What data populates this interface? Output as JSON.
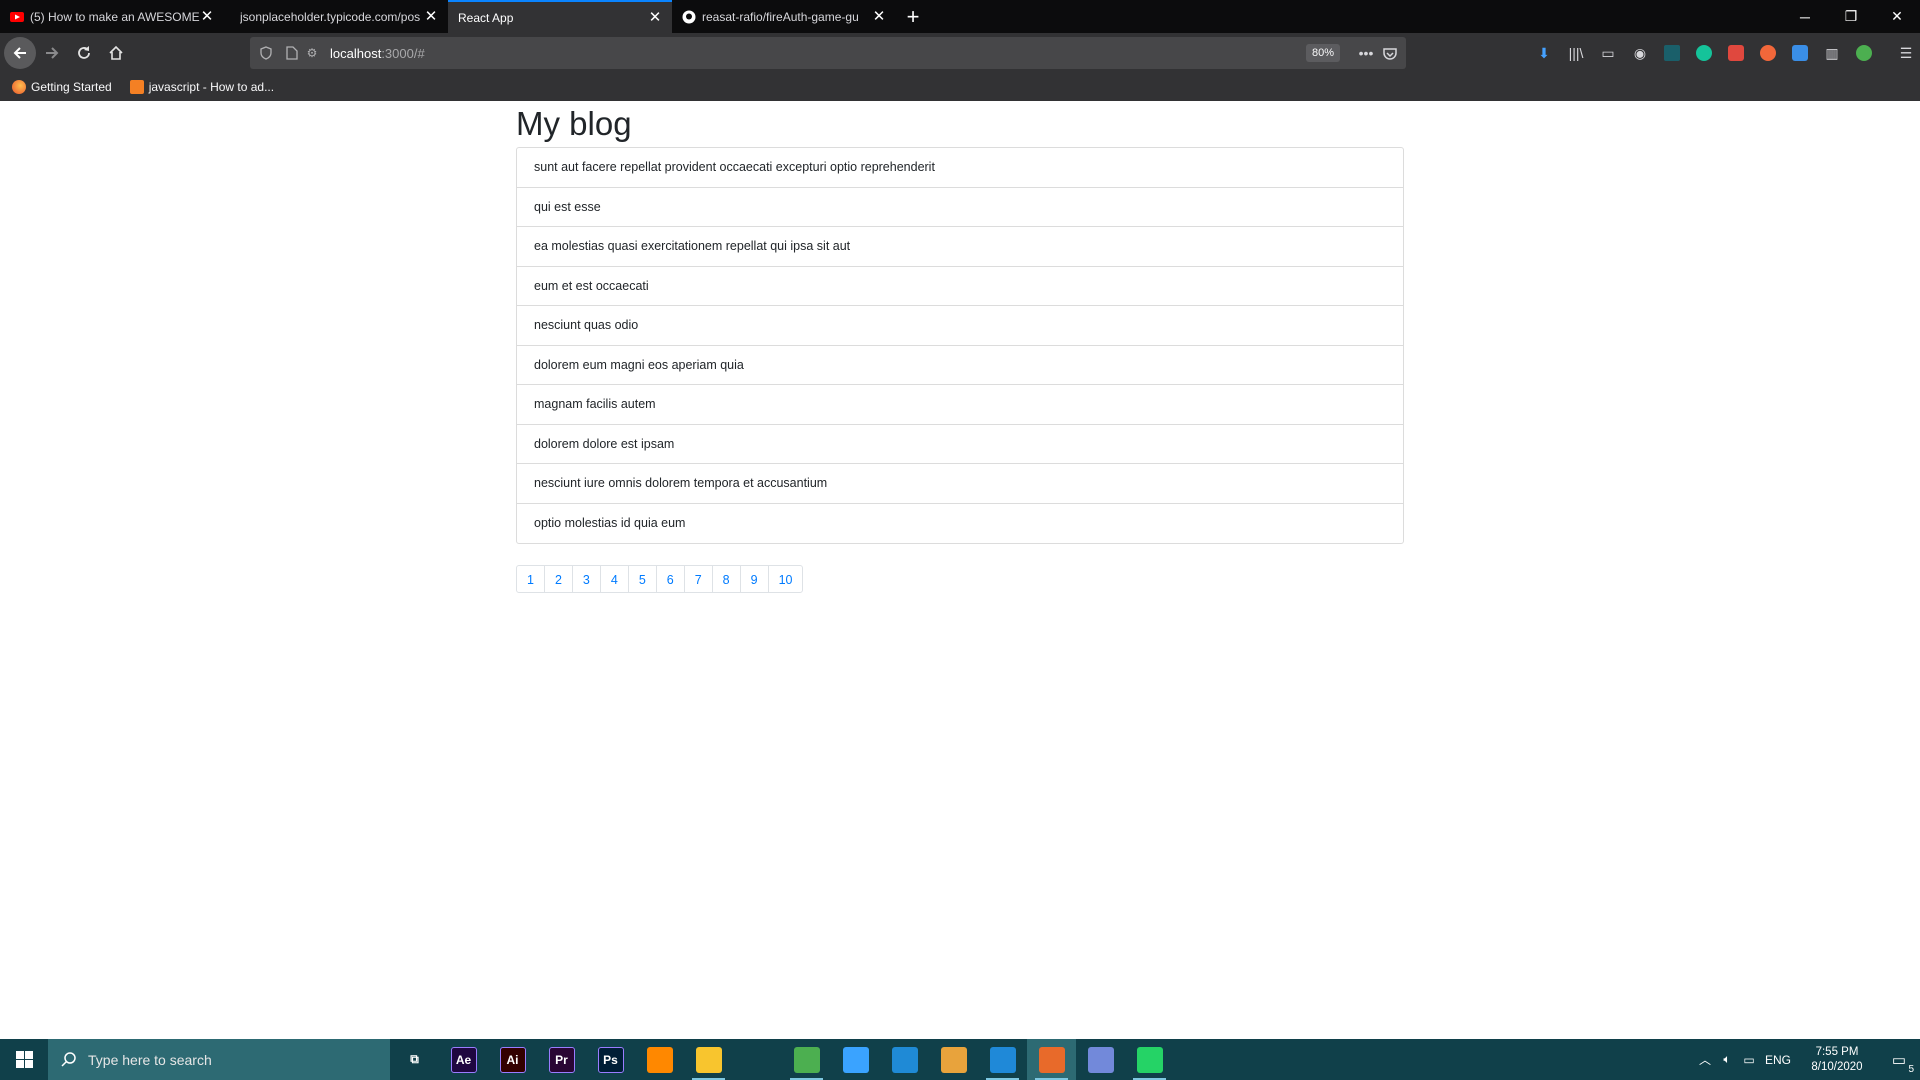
{
  "browser": {
    "tabs": [
      {
        "title": "(5) How to make an AWESOME",
        "active": false,
        "favicon": "youtube-icon"
      },
      {
        "title": "jsonplaceholder.typicode.com/pos",
        "active": false,
        "favicon": "none"
      },
      {
        "title": "React App",
        "active": true,
        "favicon": "none"
      },
      {
        "title": "reasat-rafio/fireAuth-game-gu",
        "active": false,
        "favicon": "github-icon"
      }
    ],
    "url_host": "localhost",
    "url_path": ":3000/#",
    "zoom": "80%",
    "bookmarks": [
      {
        "label": "Getting Started",
        "icon": "firefox-icon"
      },
      {
        "label": "javascript - How to ad...",
        "icon": "stackoverflow-icon"
      }
    ]
  },
  "page": {
    "heading": "My blog",
    "posts": [
      "sunt aut facere repellat provident occaecati excepturi optio reprehenderit",
      "qui est esse",
      "ea molestias quasi exercitationem repellat qui ipsa sit aut",
      "eum et est occaecati",
      "nesciunt quas odio",
      "dolorem eum magni eos aperiam quia",
      "magnam facilis autem",
      "dolorem dolore est ipsam",
      "nesciunt iure omnis dolorem tempora et accusantium",
      "optio molestias id quia eum"
    ],
    "pages": [
      "1",
      "2",
      "3",
      "4",
      "5",
      "6",
      "7",
      "8",
      "9",
      "10"
    ]
  },
  "taskbar": {
    "search_placeholder": "Type here to search",
    "apps": [
      {
        "name": "task-view",
        "label": "",
        "color": "#10404a"
      },
      {
        "name": "after-effects",
        "label": "Ae",
        "color": "#1f0740"
      },
      {
        "name": "illustrator",
        "label": "Ai",
        "color": "#330000"
      },
      {
        "name": "premiere",
        "label": "Pr",
        "color": "#2a0634"
      },
      {
        "name": "photoshop",
        "label": "Ps",
        "color": "#001e36"
      },
      {
        "name": "vlc",
        "label": "",
        "color": "#ff8800"
      },
      {
        "name": "file-explorer",
        "label": "",
        "color": "#f8c52e"
      },
      {
        "name": "store",
        "label": "",
        "color": "#10404a"
      },
      {
        "name": "chrome",
        "label": "",
        "color": "#4caf50"
      },
      {
        "name": "edit-pen",
        "label": "",
        "color": "#3aa3ff"
      },
      {
        "name": "mail",
        "label": "",
        "color": "#1f8ad6"
      },
      {
        "name": "weather",
        "label": "",
        "color": "#e8a33c"
      },
      {
        "name": "vscode",
        "label": "",
        "color": "#1f89d8"
      },
      {
        "name": "firefox",
        "label": "",
        "color": "#e86a2a"
      },
      {
        "name": "discord",
        "label": "",
        "color": "#7289da"
      },
      {
        "name": "whatsapp",
        "label": "",
        "color": "#25d366"
      }
    ],
    "language": "ENG",
    "time": "7:55 PM",
    "date": "8/10/2020",
    "notifications": "5"
  }
}
